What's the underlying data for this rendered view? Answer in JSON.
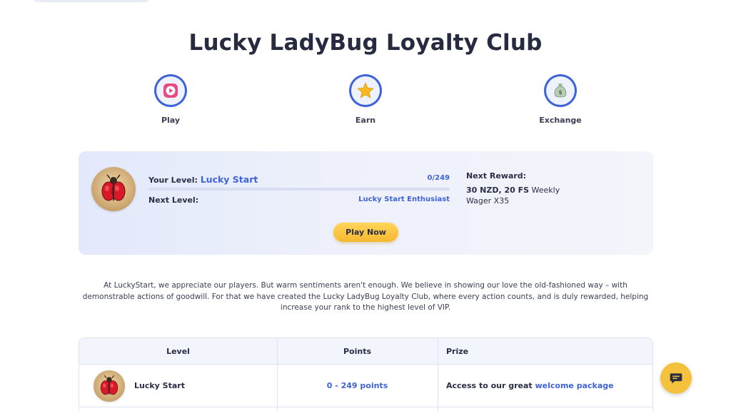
{
  "page": {
    "title": "Lucky LadyBug Loyalty Club"
  },
  "steps": [
    {
      "label": "Play",
      "icon": "play-icon"
    },
    {
      "label": "Earn",
      "icon": "star-icon"
    },
    {
      "label": "Exchange",
      "icon": "money-bag-icon"
    }
  ],
  "level_card": {
    "your_level_label": "Your Level:",
    "your_level_value": "Lucky Start",
    "progress_text": "0/249",
    "progress_fraction": 0,
    "next_level_label": "Next Level:",
    "next_level_value": "Lucky Start Enthusiast",
    "next_reward_label": "Next Reward:",
    "next_reward_strong": "30 NZD, 20 FS",
    "next_reward_rest": " Weekly Wager X35",
    "play_button": "Play Now",
    "badge_icon": "ladybug-icon"
  },
  "intro_text": "At LuckyStart, we appreciate our players. But warm sentiments aren't enough. We believe in showing our love the old-fashioned way – with demonstrable actions of goodwill. For that we have created the Lucky LadyBug Loyalty Club, where every action counts, and is duly rewarded, helping increase your rank to the highest level of VIP.",
  "table": {
    "headers": {
      "level": "Level",
      "points": "Points",
      "prize": "Prize"
    },
    "rows": [
      {
        "level": "Lucky Start",
        "points": "0 - 249 points",
        "prize_prefix": "Access to our great ",
        "prize_link": "welcome package"
      }
    ]
  },
  "chat": {
    "icon": "chat-icon"
  },
  "colors": {
    "accent": "#3f63d8",
    "button": "#f6b830",
    "title": "#262b40"
  }
}
